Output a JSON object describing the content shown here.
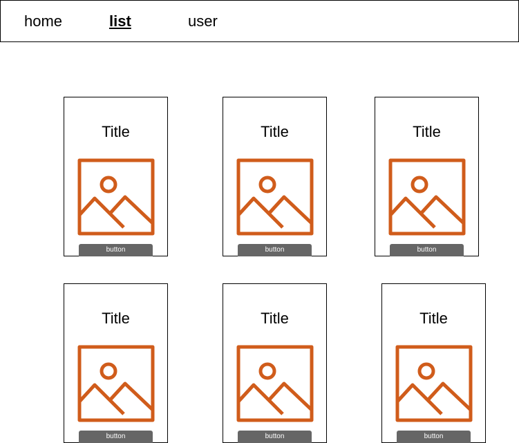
{
  "nav": {
    "items": [
      {
        "label": "home",
        "active": false
      },
      {
        "label": "list",
        "active": true
      },
      {
        "label": "user",
        "active": false
      }
    ]
  },
  "cards": [
    {
      "title": "Title",
      "button_label": "button",
      "image_icon": "image-placeholder-icon"
    },
    {
      "title": "Title",
      "button_label": "button",
      "image_icon": "image-placeholder-icon"
    },
    {
      "title": "Title",
      "button_label": "button",
      "image_icon": "image-placeholder-icon"
    },
    {
      "title": "Title",
      "button_label": "button",
      "image_icon": "image-placeholder-icon"
    },
    {
      "title": "Title",
      "button_label": "button",
      "image_icon": "image-placeholder-icon"
    },
    {
      "title": "Title",
      "button_label": "button",
      "image_icon": "image-placeholder-icon"
    }
  ],
  "colors": {
    "icon_stroke": "#D05C1B",
    "button_bg": "#666666",
    "button_text": "#FFFFFF"
  }
}
